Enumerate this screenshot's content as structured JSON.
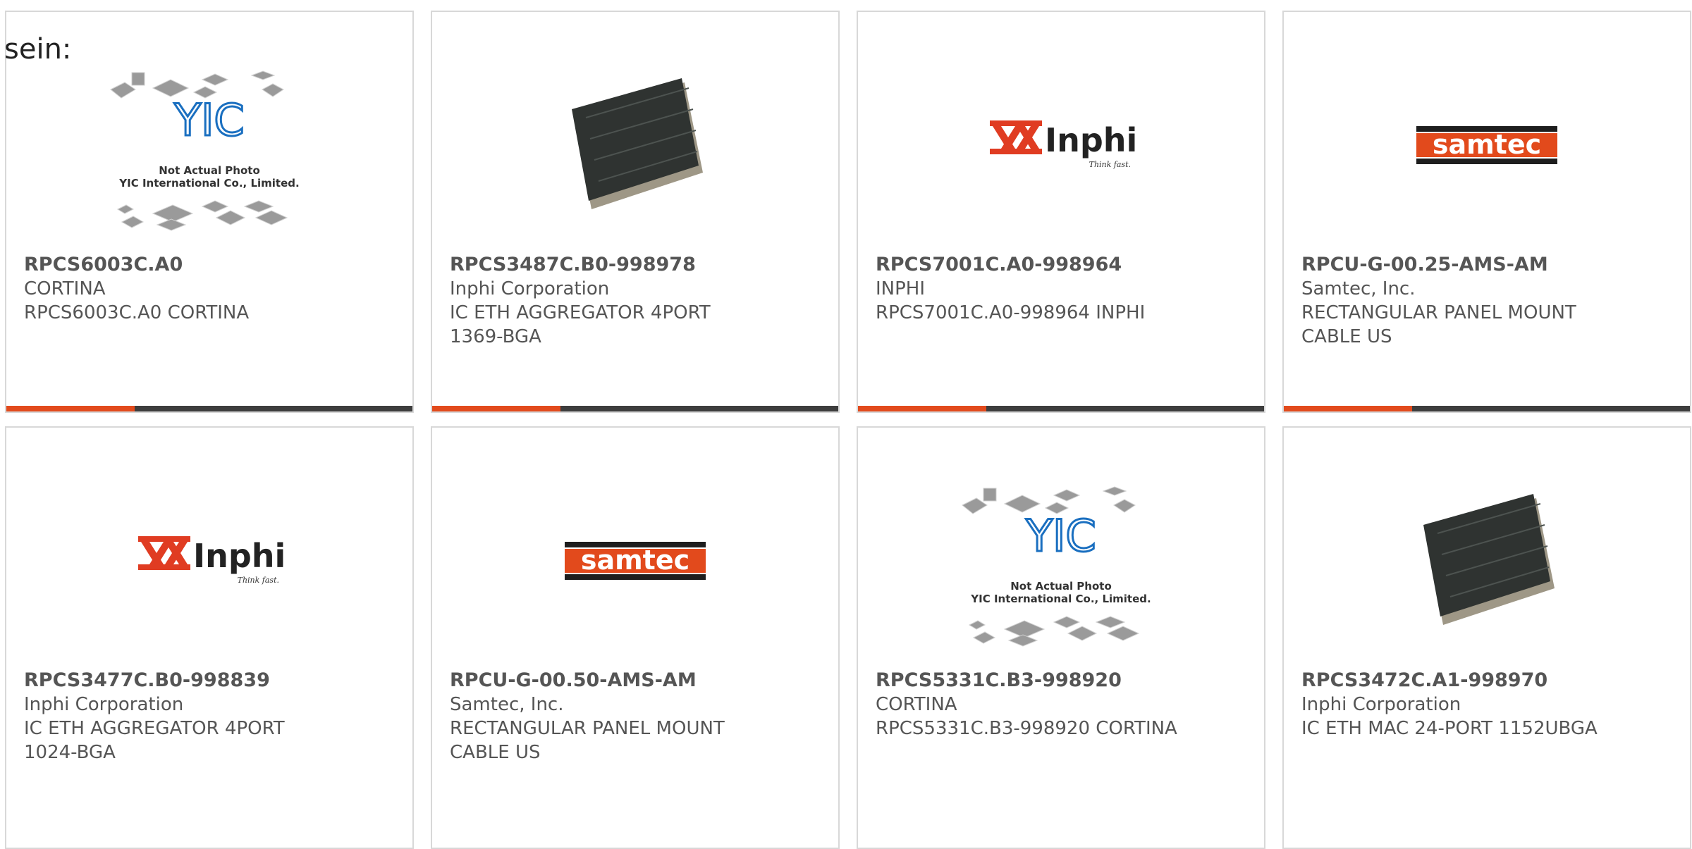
{
  "stray_text": "sein:",
  "accent_color": "#e24a1c",
  "bar_color": "#3d3d3d",
  "products": [
    {
      "part_number": "RPCS6003C.A0",
      "manufacturer": "CORTINA",
      "description": "RPCS6003C.A0 CORTINA",
      "image": "yic-placeholder",
      "image_text_1": "Not Actual Photo",
      "image_text_2": "YIC International Co., Limited.",
      "image_logo": "YIC"
    },
    {
      "part_number": "RPCS3487C.B0-998978",
      "manufacturer": "Inphi Corporation",
      "description_line1": "IC ETH AGGREGATOR 4PORT",
      "description_line2": "1369-BGA",
      "image": "bga-chip"
    },
    {
      "part_number": "RPCS7001C.A0-998964",
      "manufacturer": "INPHI",
      "description": "RPCS7001C.A0-998964 INPHI",
      "image": "inphi-logo",
      "logo_text": "Inphi",
      "logo_tagline": "Think fast."
    },
    {
      "part_number": "RPCU-G-00.25-AMS-AM",
      "manufacturer": "Samtec, Inc.",
      "description_line1": "RECTANGULAR PANEL MOUNT",
      "description_line2": "CABLE US",
      "image": "samtec-logo",
      "logo_text": "samtec"
    },
    {
      "part_number": "RPCS3477C.B0-998839",
      "manufacturer": "Inphi Corporation",
      "description_line1": "IC ETH AGGREGATOR 4PORT",
      "description_line2": "1024-BGA",
      "image": "inphi-logo",
      "logo_text": "Inphi",
      "logo_tagline": "Think fast."
    },
    {
      "part_number": "RPCU-G-00.50-AMS-AM",
      "manufacturer": "Samtec, Inc.",
      "description_line1": "RECTANGULAR PANEL MOUNT",
      "description_line2": "CABLE US",
      "image": "samtec-logo",
      "logo_text": "samtec"
    },
    {
      "part_number": "RPCS5331C.B3-998920",
      "manufacturer": "CORTINA",
      "description": "RPCS5331C.B3-998920 CORTINA",
      "image": "yic-placeholder",
      "image_text_1": "Not Actual Photo",
      "image_text_2": "YIC International Co., Limited.",
      "image_logo": "YIC"
    },
    {
      "part_number": "RPCS3472C.A1-998970",
      "manufacturer": "Inphi Corporation",
      "description": "IC ETH MAC 24-PORT 1152UBGA",
      "image": "bga-chip"
    }
  ]
}
